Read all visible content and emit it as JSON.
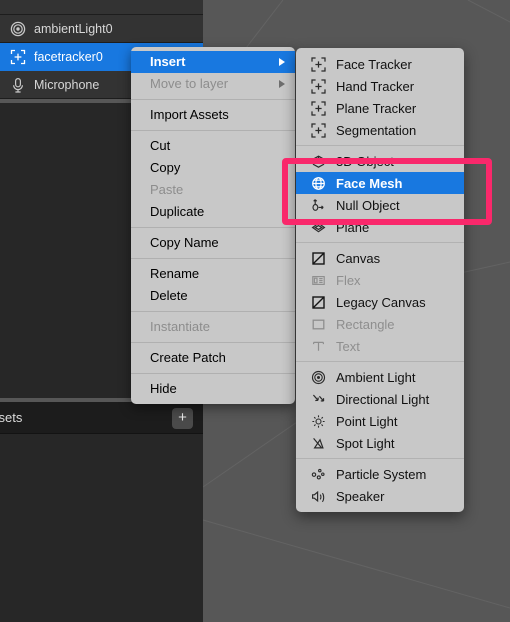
{
  "app": {
    "background_color": "#575757",
    "accent_color": "#1878e0",
    "annotation_color": "#f9286b"
  },
  "layers_panel": {
    "rows": [
      {
        "label": "",
        "icon": "cut-off-layer-icon",
        "state": "cut-off"
      },
      {
        "label": "ambientLight0",
        "icon": "ambient-light-icon",
        "state": "normal"
      },
      {
        "label": "facetracker0",
        "icon": "face-tracker-icon",
        "state": "selected"
      },
      {
        "label": "Microphone",
        "icon": "microphone-icon",
        "state": "normal"
      }
    ]
  },
  "assets_panel": {
    "title": "ssets",
    "add_button_label": "+"
  },
  "context_menu": {
    "items": [
      {
        "label": "Insert",
        "state": "highlight",
        "submenu": true
      },
      {
        "label": "Move to layer",
        "state": "disabled",
        "submenu": true
      },
      {
        "separator_after": true
      },
      {
        "label": "Import Assets",
        "state": "normal"
      },
      {
        "separator_after": true
      },
      {
        "label": "Cut",
        "state": "normal"
      },
      {
        "label": "Copy",
        "state": "normal"
      },
      {
        "label": "Paste",
        "state": "disabled"
      },
      {
        "label": "Duplicate",
        "state": "normal"
      },
      {
        "separator_after": true
      },
      {
        "label": "Copy Name",
        "state": "normal"
      },
      {
        "separator_after": true
      },
      {
        "label": "Rename",
        "state": "normal"
      },
      {
        "label": "Delete",
        "state": "normal"
      },
      {
        "separator_after": true
      },
      {
        "label": "Instantiate",
        "state": "disabled"
      },
      {
        "separator_after": true
      },
      {
        "label": "Create Patch",
        "state": "normal"
      },
      {
        "separator_after": true
      },
      {
        "label": "Hide",
        "state": "normal"
      }
    ]
  },
  "insert_submenu": {
    "groups": [
      {
        "items": [
          {
            "label": "Face Tracker",
            "icon": "tracker-bracket-plus-icon",
            "state": "normal"
          },
          {
            "label": "Hand Tracker",
            "icon": "tracker-bracket-plus-icon",
            "state": "normal"
          },
          {
            "label": "Plane Tracker",
            "icon": "tracker-bracket-plus-icon",
            "state": "normal"
          },
          {
            "label": "Segmentation",
            "icon": "tracker-bracket-plus-icon",
            "state": "normal"
          }
        ]
      },
      {
        "items": [
          {
            "label": "3D Object",
            "icon": "cube-3d-icon",
            "state": "normal"
          },
          {
            "label": "Face Mesh",
            "icon": "globe-mesh-icon",
            "state": "highlight"
          },
          {
            "label": "Null Object",
            "icon": "null-axis-icon",
            "state": "normal"
          },
          {
            "label": "Plane",
            "icon": "plane-diamond-icon",
            "state": "normal"
          }
        ]
      },
      {
        "items": [
          {
            "label": "Canvas",
            "icon": "canvas-slash-square-icon",
            "state": "normal"
          },
          {
            "label": "Flex",
            "icon": "flex-columns-icon",
            "state": "disabled"
          },
          {
            "label": "Legacy Canvas",
            "icon": "canvas-slash-square-icon",
            "state": "normal"
          },
          {
            "label": "Rectangle",
            "icon": "rectangle-icon",
            "state": "disabled"
          },
          {
            "label": "Text",
            "icon": "text-t-icon",
            "state": "disabled"
          }
        ]
      },
      {
        "items": [
          {
            "label": "Ambient Light",
            "icon": "ambient-light-icon",
            "state": "normal"
          },
          {
            "label": "Directional Light",
            "icon": "directional-light-icon",
            "state": "normal"
          },
          {
            "label": "Point Light",
            "icon": "point-light-icon",
            "state": "normal"
          },
          {
            "label": "Spot Light",
            "icon": "spot-light-icon",
            "state": "normal"
          }
        ]
      },
      {
        "items": [
          {
            "label": "Particle System",
            "icon": "particle-system-icon",
            "state": "normal"
          },
          {
            "label": "Speaker",
            "icon": "speaker-icon",
            "state": "normal"
          }
        ]
      }
    ]
  }
}
